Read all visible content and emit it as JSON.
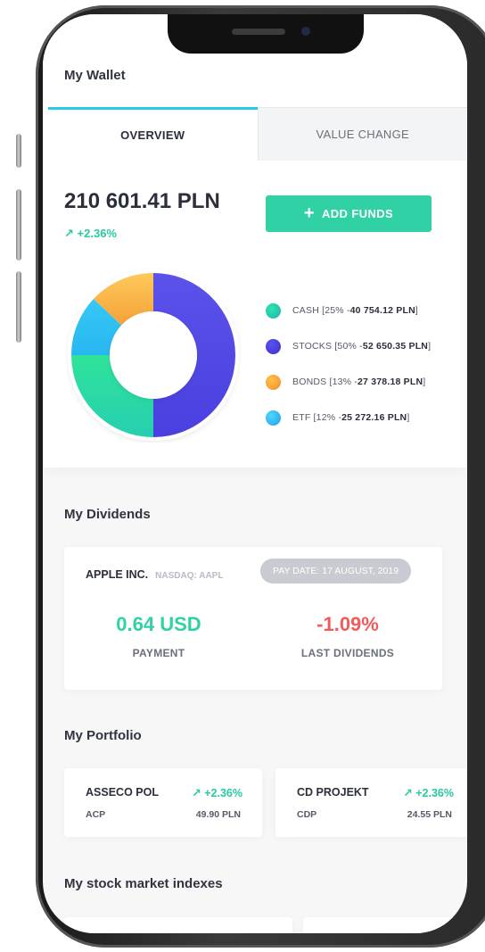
{
  "wallet": {
    "title": "My Wallet",
    "tabs": [
      "OVERVIEW",
      "VALUE CHANGE"
    ],
    "balance": "210 601.41 PLN",
    "change": "+2.36%",
    "add_funds_label": "ADD FUNDS",
    "allocation": [
      {
        "label": "CASH [25% - ",
        "value": "40 754.12 PLN",
        "close": "]",
        "percent": 25,
        "color": "#26cfb0",
        "color2": "#2fe39a"
      },
      {
        "label": "STOCKS [50% - ",
        "value": "52 650.35 PLN",
        "close": "]",
        "percent": 50,
        "color": "#4a3fe0",
        "color2": "#5b52ea"
      },
      {
        "label": "BONDS [13% - ",
        "value": "27 378.18 PLN",
        "close": "]",
        "percent": 13,
        "color": "#f5a23a",
        "color2": "#ffc95a"
      },
      {
        "label": "ETF [12% - ",
        "value": "25 272.16 PLN",
        "close": "]",
        "percent": 12,
        "color": "#28b7f0",
        "color2": "#36c8f5"
      }
    ]
  },
  "dividends": {
    "title": "My Dividends",
    "company": "APPLE INC.",
    "ticker": "NASDAQ: AAPL",
    "pay_date": "PAY DATE: 17 AUGUST, 2019",
    "payment_value": "0.64 USD",
    "payment_label": "PAYMENT",
    "last_value": "-1.09%",
    "last_label": "LAST DIVIDENDS"
  },
  "portfolio": {
    "title": "My Portfolio",
    "items": [
      {
        "name": "ASSECO POL",
        "change": "+2.36%",
        "symbol": "ACP",
        "price": "49.90 PLN"
      },
      {
        "name": "CD PROJEKT",
        "change": "+2.36%",
        "symbol": "CDP",
        "price": "24.55 PLN"
      }
    ]
  },
  "indexes": {
    "title": "My stock market indexes"
  }
}
